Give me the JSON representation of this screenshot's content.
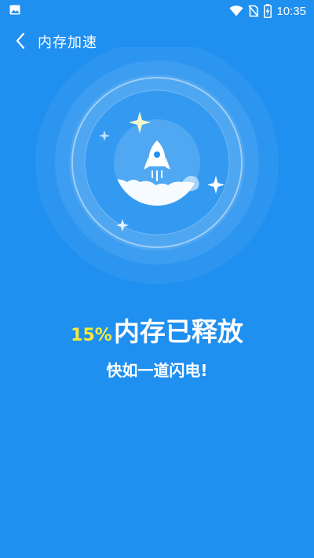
{
  "status_bar": {
    "time": "10:35",
    "left_icon": "image-icon",
    "icons": [
      "wifi-icon",
      "no-sim-icon",
      "battery-charging-icon"
    ]
  },
  "header": {
    "back_icon": "chevron-left-icon",
    "title": "内存加速"
  },
  "hero": {
    "icon": "rocket-icon",
    "decorations": [
      "sparkle-icon",
      "cloud-icon"
    ]
  },
  "result": {
    "percent": "15%",
    "message": "内存已释放",
    "subtitle": "快如一道闪电!"
  },
  "colors": {
    "background": "#1f8ff0",
    "accent": "#f4ec3b",
    "text": "#ffffff"
  }
}
